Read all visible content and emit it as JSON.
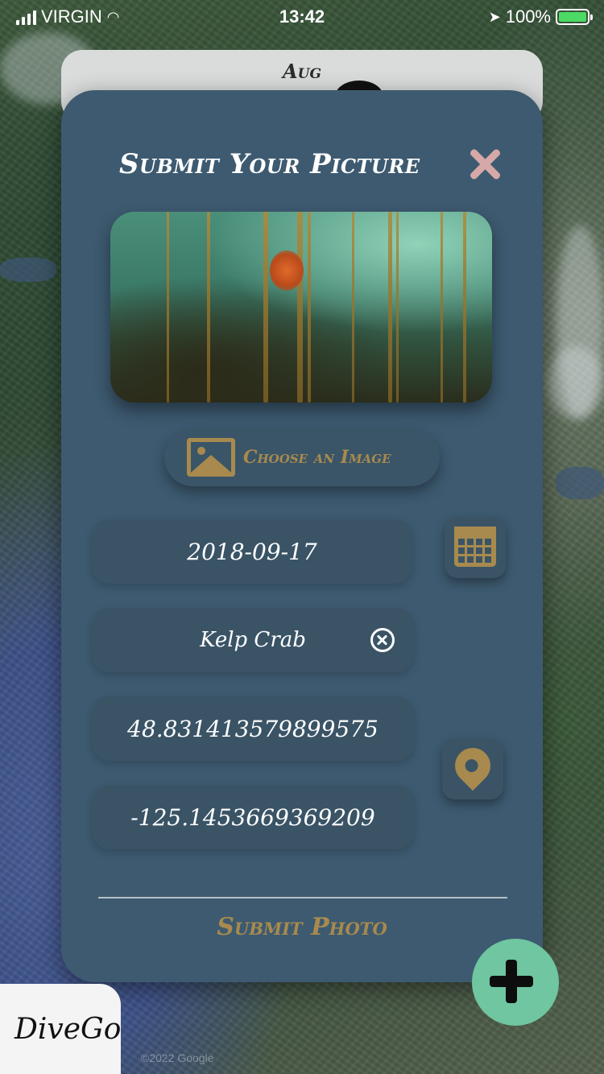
{
  "status_bar": {
    "carrier": "VIRGIN",
    "time": "13:42",
    "battery": "100%"
  },
  "background_card": {
    "title": "Aug"
  },
  "modal": {
    "title": "Submit Your Picture",
    "choose_image_label": "Choose an Image",
    "date_value": "2018-09-17",
    "species_value": "Kelp Crab",
    "latitude_value": "48.831413579899575",
    "longitude_value": "-125.1453669369209",
    "submit_label": "Submit Photo"
  },
  "brand": {
    "name": "DiveGo"
  },
  "map_credit": "©2022 Google",
  "icons": {
    "close": "close-icon",
    "image": "image-icon",
    "calendar": "calendar-icon",
    "clear": "clear-icon",
    "location": "location-pin-icon",
    "add": "plus-icon"
  },
  "colors": {
    "modal_bg": "#3d5a70",
    "accent_gold": "#a88a4e",
    "close_pink": "#d6a8a8",
    "fab_green": "#6fc6a0"
  }
}
